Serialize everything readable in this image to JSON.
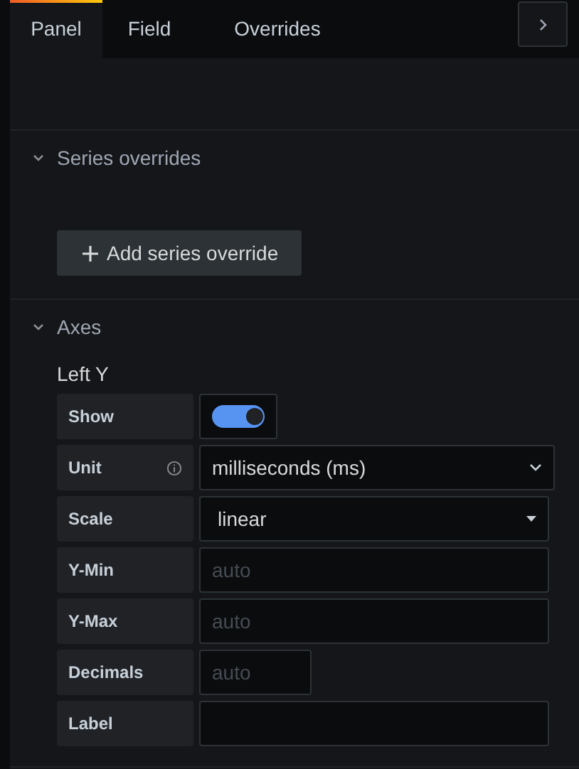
{
  "tabs": [
    {
      "label": "Panel",
      "selected": true
    },
    {
      "label": "Field",
      "selected": false
    },
    {
      "label": "Overrides",
      "selected": false
    }
  ],
  "sections": [
    {
      "title": "Series overrides",
      "expanded": true,
      "button": "Add series override"
    },
    {
      "title": "Axes",
      "expanded": true,
      "subtitle": "Left Y",
      "rows": [
        {
          "kind": "switch",
          "label": "Show",
          "on": true
        },
        {
          "kind": "select",
          "label": "Unit",
          "info": true,
          "value": "milliseconds (ms)"
        },
        {
          "kind": "dropdown",
          "label": "Scale",
          "value": "linear"
        },
        {
          "kind": "input",
          "label": "Y-Min",
          "placeholder": "auto"
        },
        {
          "kind": "input",
          "label": "Y-Max",
          "placeholder": "auto"
        },
        {
          "kind": "short-input",
          "label": "Decimals",
          "placeholder": "auto"
        },
        {
          "kind": "input",
          "label": "Label"
        }
      ]
    }
  ]
}
